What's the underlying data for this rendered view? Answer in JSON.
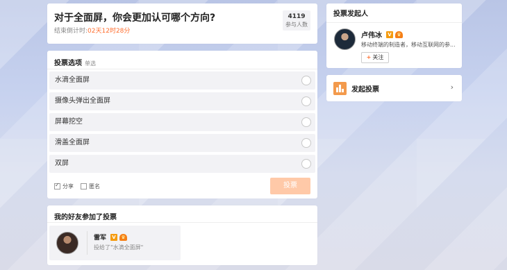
{
  "question": {
    "title": "对于全面屏，你会更加认可哪个方向?",
    "countdown_label": "结束倒计时:",
    "countdown_value": "02天12时28分",
    "participant_count": "4119",
    "participant_label": "参与人数"
  },
  "options_card": {
    "title": "投票选项",
    "mode": "单选",
    "options": [
      {
        "label": "水滴全面屏"
      },
      {
        "label": "摄像头弹出全面屏"
      },
      {
        "label": "屏幕挖空"
      },
      {
        "label": "滑盖全面屏"
      },
      {
        "label": "双屏"
      }
    ],
    "share_label": "分享",
    "share_checked": true,
    "anonymous_label": "匿名",
    "anonymous_checked": false,
    "vote_button": "投票"
  },
  "friends": {
    "title": "我的好友参加了投票",
    "items": [
      {
        "name": "雷军",
        "desc": "投给了\"水滴全面屏\""
      }
    ]
  },
  "initiator": {
    "title": "投票发起人",
    "name": "卢伟冰",
    "desc": "移动终端的制造者，移动互联网的参...",
    "follow_label": "关注"
  },
  "start_vote": {
    "label": "发起投票"
  },
  "colors": {
    "accent": "#ff6d2d",
    "vote_button_disabled": "#ffc9a8",
    "verified_badge": "#f59b0e"
  }
}
